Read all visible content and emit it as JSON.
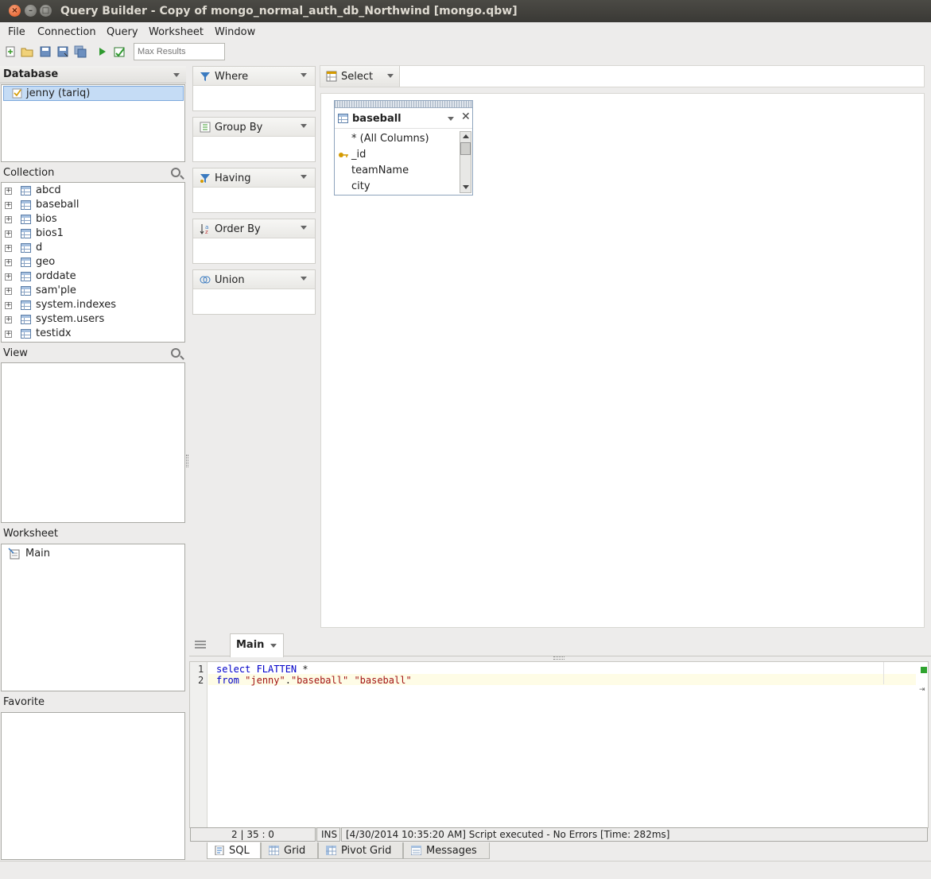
{
  "window": {
    "title": "Query Builder - Copy of mongo_normal_auth_db_Northwind [mongo.qbw]"
  },
  "menu": [
    "File",
    "Connection",
    "Query",
    "Worksheet",
    "Window"
  ],
  "toolbar": {
    "max_results_placeholder": "Max Results"
  },
  "database": {
    "header": "Database",
    "selected": "jenny (tariq)"
  },
  "collection": {
    "header": "Collection",
    "items": [
      "abcd",
      "baseball",
      "bios",
      "bios1",
      "d",
      "geo",
      "orddate",
      "sam'ple",
      "system.indexes",
      "system.users",
      "testidx"
    ]
  },
  "view": {
    "header": "View"
  },
  "worksheet": {
    "header": "Worksheet",
    "item": "Main"
  },
  "favorite": {
    "header": "Favorite"
  },
  "clauses": [
    "Where",
    "Group By",
    "Having",
    "Order By",
    "Union"
  ],
  "select": {
    "label": "Select"
  },
  "table_window": {
    "name": "baseball",
    "columns": [
      "* (All Columns)",
      "_id",
      "teamName",
      "city"
    ]
  },
  "editor": {
    "tab": "Main",
    "line_numbers": [
      "1",
      "2"
    ],
    "line1": {
      "kw": "select FLATTEN",
      "rest": " *"
    },
    "line2": {
      "kw": "from",
      "s1": "\"jenny\"",
      "dot": ".",
      "s2": "\"baseball\"",
      "s3": "\"baseball\""
    }
  },
  "status": {
    "position": "2 | 35 : 0",
    "mode": "INS",
    "message": "[4/30/2014 10:35:20 AM] Script executed - No Errors [Time: 282ms]"
  },
  "bottom_tabs": [
    "SQL",
    "Grid",
    "Pivot Grid",
    "Messages"
  ],
  "colors": {
    "accent": "#3584c8",
    "keyword": "#0000c8",
    "string": "#a31515",
    "selection": "#c5dcf5"
  }
}
